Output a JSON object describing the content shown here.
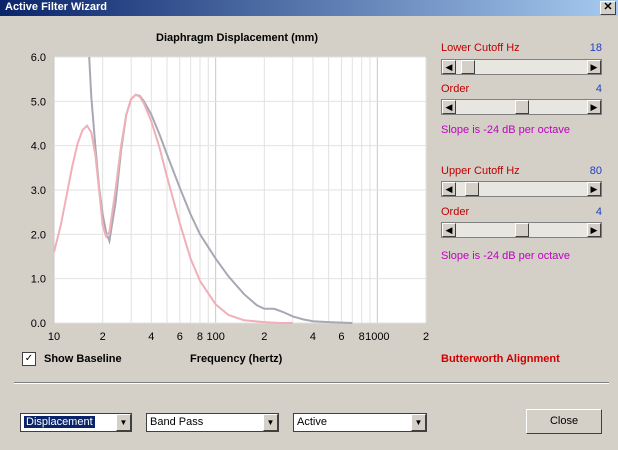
{
  "window": {
    "title": "Active Filter Wizard",
    "close_glyph": "✕"
  },
  "chart_data": {
    "type": "line",
    "title": "Diaphragm Displacement (mm)",
    "xlabel": "Frequency (hertz)",
    "ylabel": "",
    "x_scale": "log",
    "xlim": [
      10,
      2000
    ],
    "ylim": [
      0,
      6
    ],
    "grid": true,
    "y_ticks": [
      "0.0",
      "1.0",
      "2.0",
      "3.0",
      "4.0",
      "5.0",
      "6.0"
    ],
    "x_ticks": [
      {
        "value": 10,
        "label": "10"
      },
      {
        "value": 20,
        "label": "2"
      },
      {
        "value": 40,
        "label": "4"
      },
      {
        "value": 60,
        "label": "6"
      },
      {
        "value": 80,
        "label": "8"
      },
      {
        "value": 100,
        "label": "100"
      },
      {
        "value": 200,
        "label": "2"
      },
      {
        "value": 400,
        "label": "4"
      },
      {
        "value": 600,
        "label": "6"
      },
      {
        "value": 800,
        "label": "8"
      },
      {
        "value": 1000,
        "label": "1000"
      },
      {
        "value": 2000,
        "label": "2"
      }
    ],
    "series": [
      {
        "color": "#a8a8b4",
        "x": [
          16.5,
          17,
          18,
          19,
          20,
          21,
          22,
          24,
          26,
          28,
          30,
          32,
          34,
          36,
          40,
          45,
          50,
          60,
          70,
          80,
          100,
          120,
          150,
          180,
          200,
          230,
          260,
          300,
          350,
          400,
          500,
          600,
          700
        ],
        "y": [
          6.0,
          5.1,
          4.0,
          3.05,
          2.45,
          2.05,
          1.85,
          2.7,
          3.9,
          4.7,
          5.05,
          5.15,
          5.12,
          5.0,
          4.7,
          4.25,
          3.8,
          3.05,
          2.45,
          2.0,
          1.45,
          1.05,
          0.65,
          0.4,
          0.32,
          0.32,
          0.25,
          0.15,
          0.08,
          0.04,
          0.02,
          0.01,
          0.0
        ]
      },
      {
        "color": "#f0b0b8",
        "x": [
          10,
          11,
          12,
          13,
          14,
          15,
          16,
          17,
          18,
          19,
          20,
          21,
          22,
          24,
          26,
          28,
          30,
          32,
          34,
          36,
          40,
          45,
          50,
          60,
          70,
          80,
          100,
          120,
          150,
          200,
          250,
          300
        ],
        "y": [
          1.6,
          2.2,
          2.9,
          3.55,
          4.05,
          4.35,
          4.45,
          4.3,
          3.8,
          3.0,
          2.2,
          1.95,
          2.05,
          3.0,
          4.0,
          4.7,
          5.05,
          5.15,
          5.1,
          4.95,
          4.55,
          3.95,
          3.3,
          2.25,
          1.45,
          0.95,
          0.42,
          0.18,
          0.06,
          0.02,
          0.0,
          0.0
        ]
      }
    ]
  },
  "filters": {
    "lower_cutoff": {
      "label": "Lower Cutoff  Hz",
      "value": "18",
      "thumb_fraction": 0.04
    },
    "lower_order": {
      "label": "Order",
      "value": "4",
      "thumb_fraction": 0.5,
      "slope_text": "Slope is -24 dB per octave"
    },
    "upper_cutoff": {
      "label": "Upper Cutoff  Hz",
      "value": "80",
      "thumb_fraction": 0.08
    },
    "upper_order": {
      "label": "Order",
      "value": "4",
      "thumb_fraction": 0.5,
      "slope_text": "Slope is -24 dB per octave"
    }
  },
  "options": {
    "show_baseline_label": "Show Baseline",
    "show_baseline_checked": true,
    "check_glyph": "✓",
    "alignment": "Butterworth Alignment"
  },
  "bottom": {
    "plot_type": "Displacement",
    "filter_type": "Band Pass",
    "filter_mode": "Active",
    "close_label": "Close",
    "arrow_left": "◀",
    "arrow_right": "▶",
    "dropdown_glyph": "▼"
  }
}
